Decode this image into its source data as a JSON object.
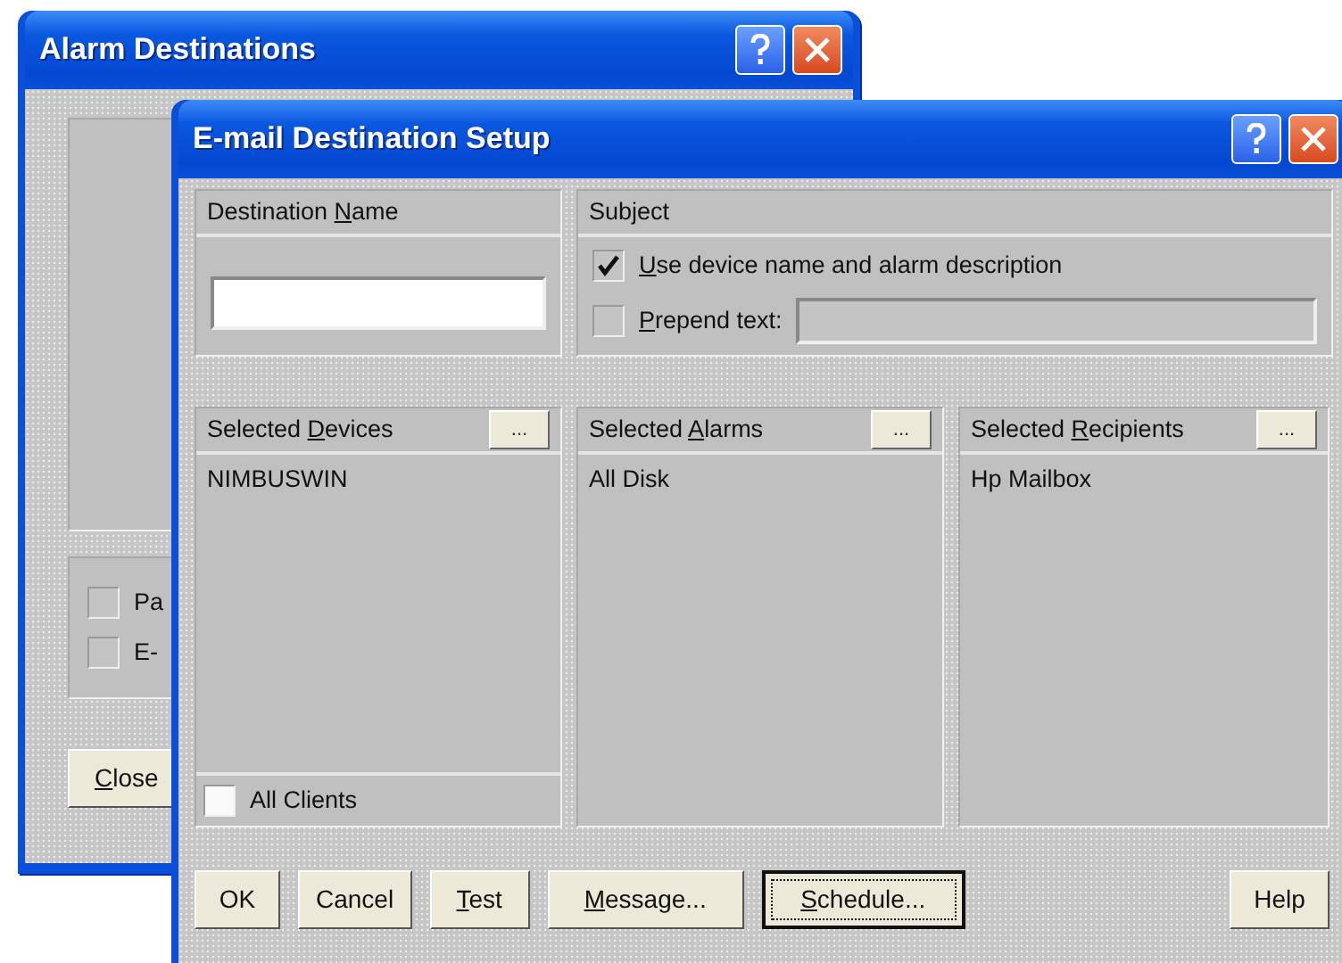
{
  "back_window": {
    "title": "Alarm Destinations",
    "options": [
      {
        "label": "Pa",
        "checked": false
      },
      {
        "label": "E-",
        "checked": false
      }
    ],
    "close_button": {
      "label": {
        "key": "C",
        "post": "lose"
      }
    }
  },
  "dialog": {
    "title": "E-mail Destination Setup",
    "destination_name": {
      "label": {
        "pre": "Destination ",
        "key": "N",
        "post": "ame"
      }
    },
    "subject": {
      "label": {
        "pre": "Subject"
      },
      "options": [
        {
          "kind": "plain",
          "label": {
            "key": "U",
            "post": "se device name and alarm description"
          },
          "checked": true
        },
        {
          "kind": "with_field",
          "label": {
            "key": "P",
            "post": "repend text:"
          },
          "checked": false,
          "field_disabled": true
        }
      ]
    },
    "lists": [
      {
        "label": {
          "pre": "Selected ",
          "key": "D",
          "post": "evices"
        },
        "browse": "...",
        "items": [
          "NIMBUSWIN"
        ],
        "footer_checkbox": {
          "label": "All Clients",
          "checked": false
        }
      },
      {
        "label": {
          "pre": "Selected ",
          "key": "A",
          "post": "larms"
        },
        "browse": "...",
        "items": [
          "All Disk"
        ]
      },
      {
        "label": {
          "pre": "Selected ",
          "key": "R",
          "post": "ecipients"
        },
        "browse": "...",
        "items": [
          "Hp Mailbox"
        ]
      }
    ],
    "buttons": [
      {
        "label": {
          "pre": "OK"
        },
        "align_right": false,
        "default": false
      },
      {
        "label": {
          "pre": "Cancel"
        },
        "align_right": false,
        "default": false
      },
      {
        "label": {
          "key": "T",
          "post": "est"
        },
        "align_right": false,
        "default": false
      },
      {
        "label": {
          "key": "M",
          "post": "essage..."
        },
        "align_right": false,
        "default": false
      },
      {
        "label": {
          "key": "S",
          "post": "chedule..."
        },
        "align_right": false,
        "default": true
      },
      {
        "label": {
          "pre": "Help"
        },
        "align_right": true,
        "default": false
      }
    ]
  }
}
